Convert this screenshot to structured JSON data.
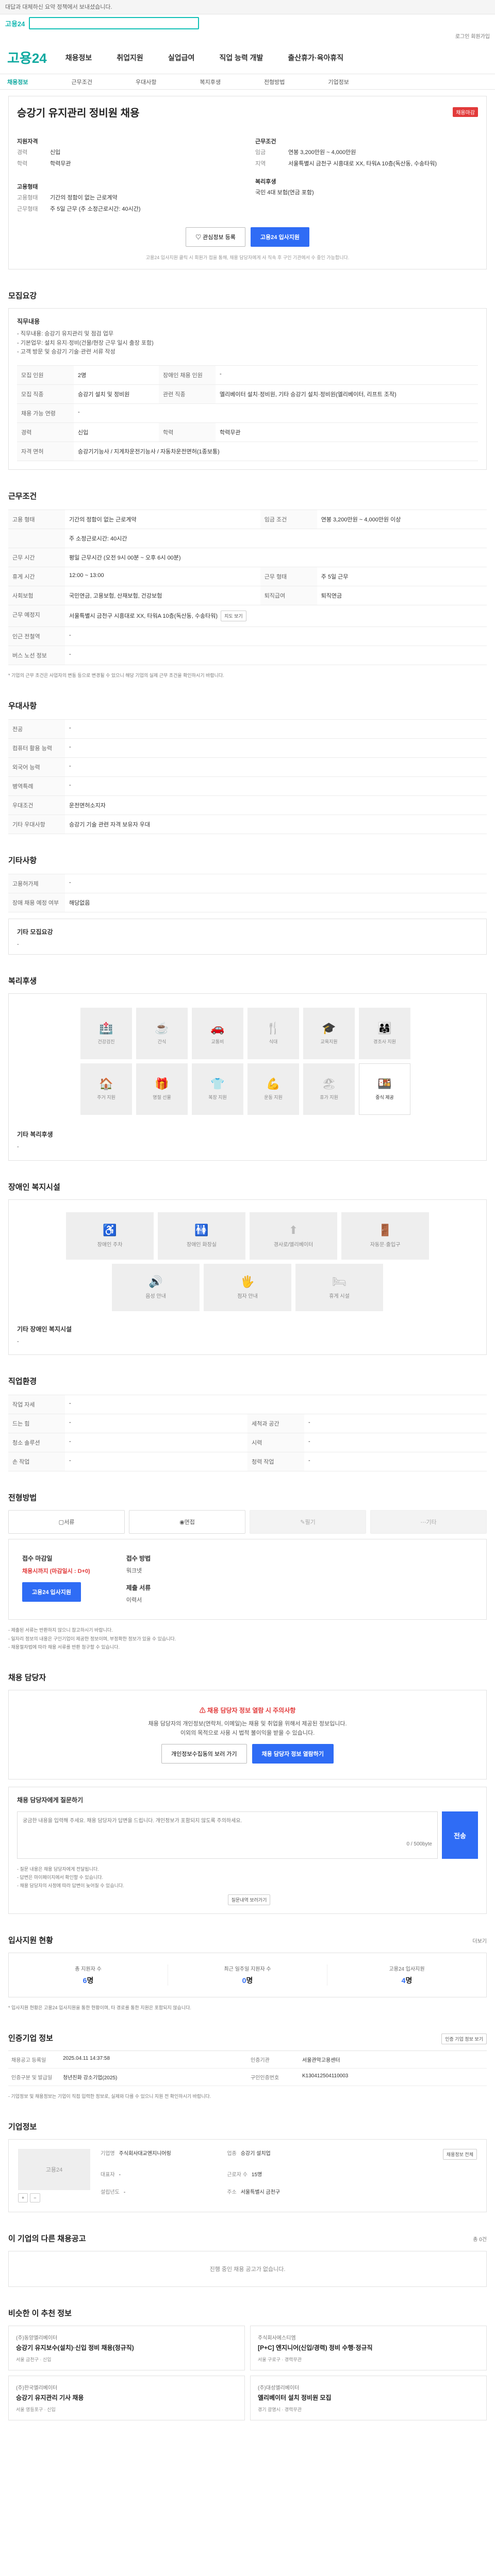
{
  "top": {
    "notice": "대답과 대체하신 요약 정책에서 보내셨습니다.",
    "logo": "고용24",
    "utility": "로그인  회원가입"
  },
  "gnb": {
    "brand": "고용24",
    "items": [
      "채용정보",
      "취업지원",
      "실업급여",
      "직업 능력 개발",
      "출산휴가·육아휴직"
    ]
  },
  "subnav": [
    "채용정보",
    "근무조건",
    "우대사항",
    "복지후생",
    "전형방법",
    "기업정보"
  ],
  "job": {
    "title": "승강기 유지관리 정비원 채용",
    "badge": "채용마감",
    "company_h": "지원자격",
    "company_rows": [
      {
        "k": "경력",
        "v": "신입"
      },
      {
        "k": "학력",
        "v": "학력무관"
      }
    ],
    "cond_h": "근무조건",
    "cond_rows": [
      {
        "k": "임금",
        "v": "연봉 3,200만원 ~ 4,000만원"
      },
      {
        "k": "지역",
        "v": "서울특별시 금천구 시흥대로 XX, 타워A 10층(독산동, 수송타워)"
      }
    ],
    "emp_h": "고용형태",
    "emp_rows": [
      {
        "k": "고용형태",
        "v": "기간의 정함이 없는 근로계약"
      },
      {
        "k": "근무형태",
        "v": "주 5일 근무 (주 소정근로시간: 40시간)"
      }
    ],
    "work_h": "복리후생",
    "work_rows": [
      {
        "k": "",
        "v": "국민 4대 보험(연금 포함)"
      }
    ],
    "btn_fav": "관심정보 등록",
    "btn_apply": "고용24 입사지원",
    "note": "고용24 입사지원 클릭 시 회원가 접을 통해, 채용 담당자에게 사 직속 후 구인 기관에서 수 중인 가능합니다."
  },
  "recruit": {
    "title": "모집요강",
    "duty_h": "직무내용",
    "duty_lines": [
      "- 직무내용: 승강기 유지관리 및 점검 업무",
      "- 기본업무: 설치 유지·정비(건물/현장 근무 일시 출장 포함)",
      "- 고객 방문 및 승강기 기술·관련 서류 작성"
    ],
    "rows": [
      {
        "k": "모집 인원",
        "v": "2명",
        "k2": "장애인 채용 인원",
        "v2": "-"
      },
      {
        "k": "모집 직종",
        "v": "승강기 설치 및 정비원",
        "k2": "관련 직종",
        "v2": "엘리베이터 설치·정비원, 기타 승강기 설치·정비원(엘리베이터, 리프트 조작)"
      },
      {
        "k": "채용 가능 연령",
        "v": "-",
        "k2": "",
        "v2": ""
      },
      {
        "k": "경력",
        "v": "신입",
        "k2": "학력",
        "v2": "학력무관"
      },
      {
        "k": "자격 면허",
        "v": "승강기기능사 / 지게차운전기능사 / 자동차운전면허(1종보통)",
        "k2": "",
        "v2": ""
      }
    ]
  },
  "work": {
    "title": "근무조건",
    "rows": [
      {
        "k": "고용 형태",
        "v": "기간의 정함이 없는 근로계약",
        "k2": "임금 조건",
        "v2": "연봉 3,200만원 ~ 4,000만원 이상"
      },
      {
        "k": "",
        "v": "주 소정근로시간: 40시간",
        "k2": "",
        "v2": ""
      },
      {
        "k": "근무 시간",
        "v": "평일 근무시간 (오전 9시 00분 ~ 오후 6시 00분)",
        "k2": "",
        "v2": ""
      },
      {
        "k": "휴게 시간",
        "v": "12:00 ~ 13:00",
        "k2": "근무 형태",
        "v2": "주 5일 근무"
      },
      {
        "k": "사회보험",
        "v": "국민연금, 고용보험, 산재보험, 건강보험",
        "k2": "퇴직급여",
        "v2": "퇴직연금"
      },
      {
        "k": "근무 예정지",
        "v": "서울특별시 금천구 시흥대로 XX, 타워A 10층(독산동, 수송타워)",
        "k2": "",
        "v2": ""
      },
      {
        "k": "인근 전철역",
        "v": "-",
        "k2": "",
        "v2": ""
      },
      {
        "k": "버스 노선 정보",
        "v": "-",
        "k2": "",
        "v2": ""
      }
    ],
    "map_btn": "지도 보기",
    "footnote": "* 기업의 근무 조건은 사업자의 변동 등으로 변경될 수 있으니 해당 기업의 실제 근무 조건을 확인하시기 바랍니다."
  },
  "pref": {
    "title": "우대사항",
    "rows": [
      {
        "k": "전공",
        "v": "-"
      },
      {
        "k": "컴퓨터 활용 능력",
        "v": "-"
      },
      {
        "k": "외국어 능력",
        "v": "-"
      },
      {
        "k": "병역특례",
        "v": "-"
      },
      {
        "k": "우대조건",
        "v": "운전면허소지자"
      },
      {
        "k": "기타 우대사항",
        "v": "승강기 기술 관련 자격 보유자 우대"
      }
    ]
  },
  "extra": {
    "title": "기타사항",
    "rows": [
      {
        "k": "고용허가제",
        "v": "-"
      },
      {
        "k": "장애 채용 예정 여부",
        "v": "해당없음"
      }
    ],
    "other_h": "기타 모집요강",
    "other_v": "-"
  },
  "welfare": {
    "title": "복리후생",
    "items": [
      {
        "icon": "🏥",
        "label": "건강검진"
      },
      {
        "icon": "☕",
        "label": "간식"
      },
      {
        "icon": "🚗",
        "label": "교통비"
      },
      {
        "icon": "🍴",
        "label": "식대"
      },
      {
        "icon": "🎓",
        "label": "교육지원"
      },
      {
        "icon": "👨‍👩‍👧",
        "label": "경조사 지원"
      },
      {
        "icon": "🏠",
        "label": "주거 지원"
      },
      {
        "icon": "🎁",
        "label": "명절 선물"
      },
      {
        "icon": "👕",
        "label": "복장 지원"
      },
      {
        "icon": "💪",
        "label": "운동 지원"
      },
      {
        "icon": "🏖",
        "label": "휴가 지원"
      },
      {
        "icon": "🍱",
        "label": "중식 제공",
        "on": true
      }
    ],
    "other_h": "기타 복리후생",
    "other_v": "-"
  },
  "disability": {
    "title": "장애인 복지시설",
    "items": [
      {
        "icon": "♿",
        "label": "장애인 주차"
      },
      {
        "icon": "🚻",
        "label": "장애인 화장실"
      },
      {
        "icon": "⬆",
        "label": "경사로/엘리베이터"
      },
      {
        "icon": "🚪",
        "label": "자동문·출입구"
      },
      {
        "icon": "🔊",
        "label": "음성 안내"
      },
      {
        "icon": "🖐",
        "label": "점자 안내"
      },
      {
        "icon": "🛏",
        "label": "휴게 시설"
      }
    ],
    "other_h": "기타 장애인 복지시설",
    "other_v": "-"
  },
  "dispatch": {
    "title": "직업환경",
    "rows": [
      {
        "k": "작업 자세",
        "v": "-",
        "k2": "",
        "v2": ""
      },
      {
        "k": "드는 힘",
        "v": "-",
        "k2": "세척과 공간",
        "v2": "-"
      },
      {
        "k": "청소 솔루션",
        "v": "-",
        "k2": "시력",
        "v2": "-"
      },
      {
        "k": "손 작업",
        "v": "-",
        "k2": "청력 작업",
        "v2": "-"
      }
    ]
  },
  "process": {
    "title": "전형방법",
    "steps": [
      {
        "label": "서류",
        "off": false
      },
      {
        "label": "면접",
        "off": false
      },
      {
        "label": "필기",
        "off": true
      },
      {
        "label": "기타",
        "off": true
      }
    ],
    "end_h": "접수 마감일",
    "end_v": "채용시까지 (마감일시 : D+0)",
    "method_h": "접수 방법",
    "method_v": "워크넷",
    "doc_h": "제출 서류",
    "doc_v": "이력서",
    "apply_btn": "고용24 입사지원",
    "notes": [
      "- 제출된 서류는 반환하지 않으니 참고하시기 바랍니다.",
      "- 일자리 정보의 내용은 구인기업이 제공한 정보이며, 부정확한 정보가 있을 수 있습니다.",
      "- 채용절차법에 따라 채용 서류를 반환 청구할 수 있습니다."
    ]
  },
  "manager": {
    "title": "채용 담당자",
    "alert": "채용 담당자 정보 열람 시 주의사항",
    "desc1": "채용 담당자의 개인정보(연락처, 이메일)는 채용 및 취업을 위해서 제공된 정보입니다.",
    "desc2": "이외의 목적으로 사용 시 법적 불이익을 받을 수 있습니다.",
    "btn1": "개인정보수집동의 보러 가기",
    "btn2": "채용 담당자 정보 열람하기",
    "q_h": "채용 담당자에게 질문하기",
    "q_placeholder": "궁금한 내용을 입력해 주세요. 채용 담당자가 답변을 드립니다. 개인정보가 포함되지 않도록 주의하세요.",
    "q_count": "0 / 500byte",
    "q_send": "전송",
    "q_notes": [
      "- 질문 내용은 채용 담당자에게 전달됩니다.",
      "- 답변은 마이페이지에서 확인할 수 있습니다.",
      "- 채용 담당자의 사정에 따라 답변이 늦어질 수 있습니다."
    ],
    "q_btn": "질문내역 보러가기"
  },
  "applicants": {
    "title": "입사지원 현황",
    "more": "더보기",
    "stats": [
      {
        "label": "총 지원자 수",
        "value": "6",
        "unit": "명"
      },
      {
        "label": "최근 일주일 지원자 수",
        "value": "0",
        "unit": "명"
      },
      {
        "label": "고용24 입사지원",
        "value": "4",
        "unit": "명"
      }
    ],
    "note": "* 입사지원 현황은 고용24 입사지원을 통한 현황이며, 타 경로를 통한 지원은 포함되지 않습니다."
  },
  "jobinfo": {
    "title": "인증기업 정보",
    "btn": "인증 기업 정보 보기",
    "cells": [
      {
        "k": "채용공고 등록일",
        "v": "2025.04.11 14:37:58"
      },
      {
        "k": "인증기관",
        "v": "서울관악고용센터"
      },
      {
        "k": "인증구분 및 발급일",
        "v": "청년친화 강소기업(2025)"
      },
      {
        "k": "구인인증번호",
        "v": "K130412504110003"
      }
    ],
    "note": "- 기업정보 및 채용정보는 기업이 직접 입력한 정보로, 실제와 다를 수 있으니 지원 전 확인하시기 바랍니다."
  },
  "corp": {
    "title": "기업정보",
    "logo": "고용24",
    "name_btn": "채용정보 전체",
    "rows": [
      {
        "k": "기업명",
        "v": "주식회사대교엔지니어링"
      },
      {
        "k": "업종",
        "v": "승강기 설치업"
      },
      {
        "k": "대표자",
        "v": "-"
      },
      {
        "k": "근로자 수",
        "v": "15명"
      },
      {
        "k": "설립년도",
        "v": "-"
      },
      {
        "k": "주소",
        "v": "서울특별시 금천구"
      }
    ]
  },
  "others": {
    "title": "이 기업의 다른 채용공고",
    "count": "총 0건",
    "empty": "진행 중인 채용 공고가 없습니다."
  },
  "reco": {
    "title": "비슷한 이 추천 정보",
    "cards": [
      {
        "co": "(주)동양엘리베이터",
        "title": "승강기 유지보수(설치)·신입 정비 채용(정규직)",
        "meta": "서울 금천구 · 신입"
      },
      {
        "co": "주식회사에스티엠",
        "title": "[P+C] 엔지니어(신입/경력) 정비 수행·정규직",
        "meta": "서울 구로구 · 경력무관"
      },
      {
        "co": "(주)한국엘리베이터",
        "title": "승강기 유지관리 기사 채용",
        "meta": "서울 영등포구 · 신입"
      },
      {
        "co": "(주)대성엘리베이터",
        "title": "엘리베이터 설치 정비원 모집",
        "meta": "경기 광명시 · 경력무관"
      }
    ]
  }
}
